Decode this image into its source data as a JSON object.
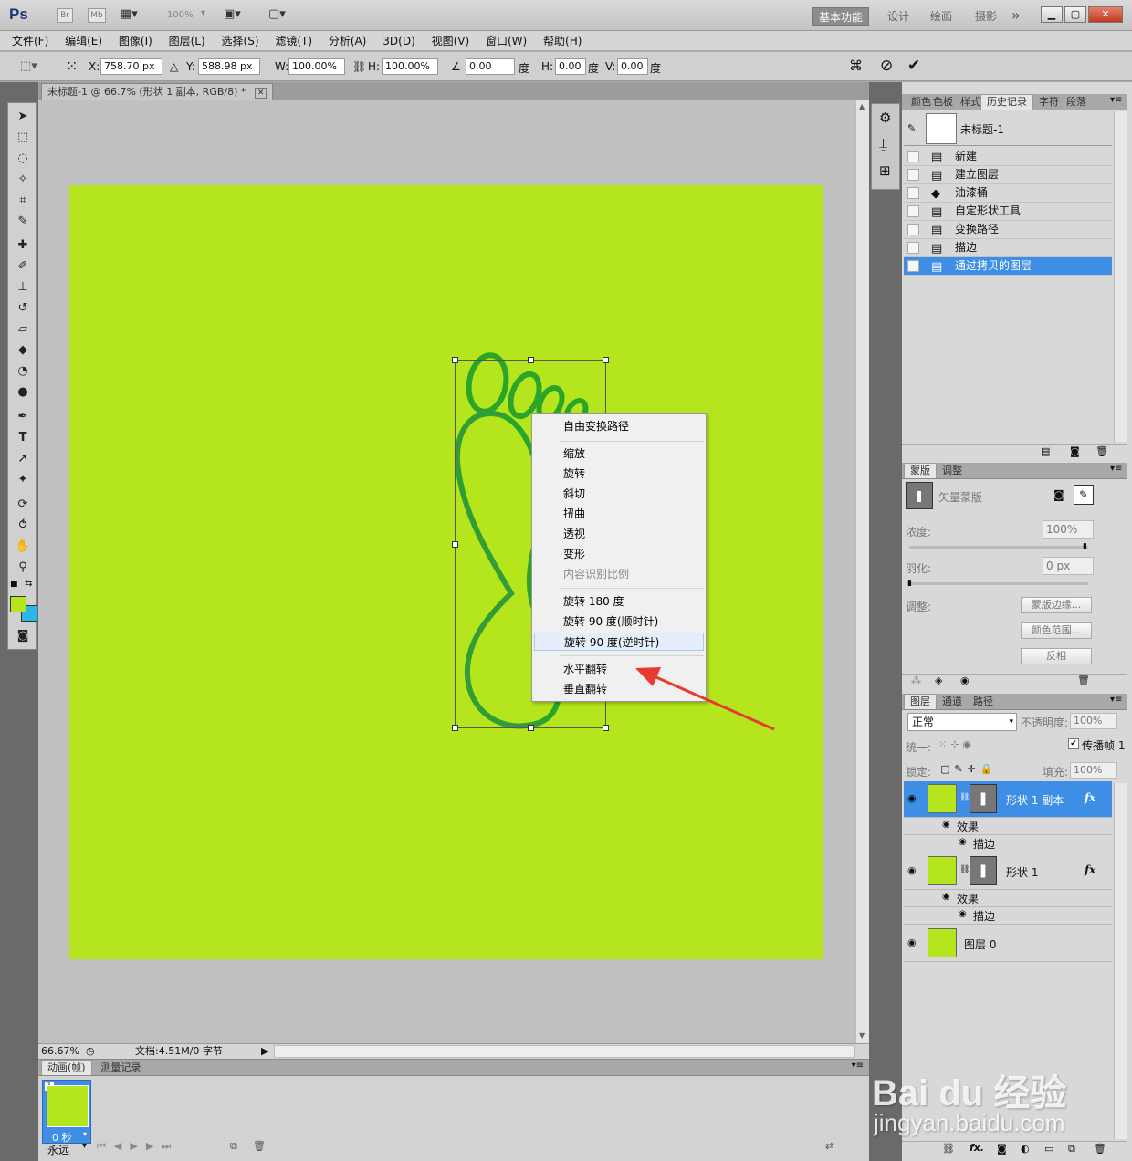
{
  "titlebar": {
    "logo": "Ps",
    "bridge": "Br",
    "minibridge": "Mb",
    "zoom": "100%",
    "workspaces": [
      "基本功能",
      "设计",
      "绘画",
      "摄影"
    ],
    "more": "»"
  },
  "menu": [
    "文件(F)",
    "编辑(E)",
    "图像(I)",
    "图层(L)",
    "选择(S)",
    "滤镜(T)",
    "分析(A)",
    "3D(D)",
    "视图(V)",
    "窗口(W)",
    "帮助(H)"
  ],
  "options": {
    "x_label": "X:",
    "x": "758.70 px",
    "y_label": "Y:",
    "y": "588.98 px",
    "w_label": "W:",
    "w": "100.00%",
    "h_label": "H:",
    "h": "100.00%",
    "angle": "0.00",
    "deg": "度",
    "hskew_label": "H:",
    "hskew": "0.00",
    "vskew_label": "V:",
    "vskew": "0.00"
  },
  "document": {
    "tab_title": "未标题-1 @ 66.7% (形状 1 副本, RGB/8) *",
    "canvas_color": "#b5e51d",
    "zoom_status": "66.67%",
    "doc_status": "文档:4.51M/0 字节"
  },
  "context_menu": {
    "items": [
      "自由变换路径",
      "缩放",
      "旋转",
      "斜切",
      "扭曲",
      "透视",
      "变形",
      "内容识别比例",
      "旋转 180 度",
      "旋转 90 度(顺时针)",
      "旋转 90 度(逆时针)",
      "水平翻转",
      "垂直翻转"
    ],
    "disabled": "内容识别比例",
    "highlighted": "旋转 90 度(逆时针)"
  },
  "annotation": {
    "arrow_color": "#e83a2e",
    "target": "水平翻转"
  },
  "history_panel": {
    "tabs": [
      "颜色",
      "色板",
      "样式",
      "历史记录",
      "字符",
      "段落"
    ],
    "active_tab": "历史记录",
    "snapshot": "未标题-1",
    "steps": [
      "新建",
      "建立图层",
      "油漆桶",
      "自定形状工具",
      "变换路径",
      "描边",
      "通过拷贝的图层"
    ],
    "selected_step": "通过拷贝的图层"
  },
  "mask_panel": {
    "tabs": [
      "蒙版",
      "调整"
    ],
    "type": "矢量蒙版",
    "density_label": "浓度:",
    "density": "100%",
    "feather_label": "羽化:",
    "feather": "0 px",
    "refine_label": "调整:",
    "btn_edge": "蒙版边缘...",
    "btn_color": "颜色范围...",
    "btn_invert": "反相"
  },
  "layers_panel": {
    "tabs": [
      "图层",
      "通道",
      "路径"
    ],
    "blend_mode": "正常",
    "opacity_label": "不透明度:",
    "opacity": "100%",
    "unify_label": "统一:",
    "propagate_label": "传播帧 1",
    "lock_label": "锁定:",
    "fill_label": "填充:",
    "fill": "100%",
    "layers": [
      {
        "name": "形状 1 副本",
        "effects": "效果",
        "stroke": "描边",
        "fx": "fx"
      },
      {
        "name": "形状 1",
        "effects": "效果",
        "stroke": "描边",
        "fx": "fx"
      },
      {
        "name": "图层 0"
      }
    ]
  },
  "animation_panel": {
    "tabs": [
      "动画(帧)",
      "测量记录"
    ],
    "frame_number": "1",
    "frame_delay": "0 秒",
    "loop": "永远"
  },
  "watermark": {
    "brand": "Bai du 经验",
    "url": "jingyan.baidu.com"
  }
}
